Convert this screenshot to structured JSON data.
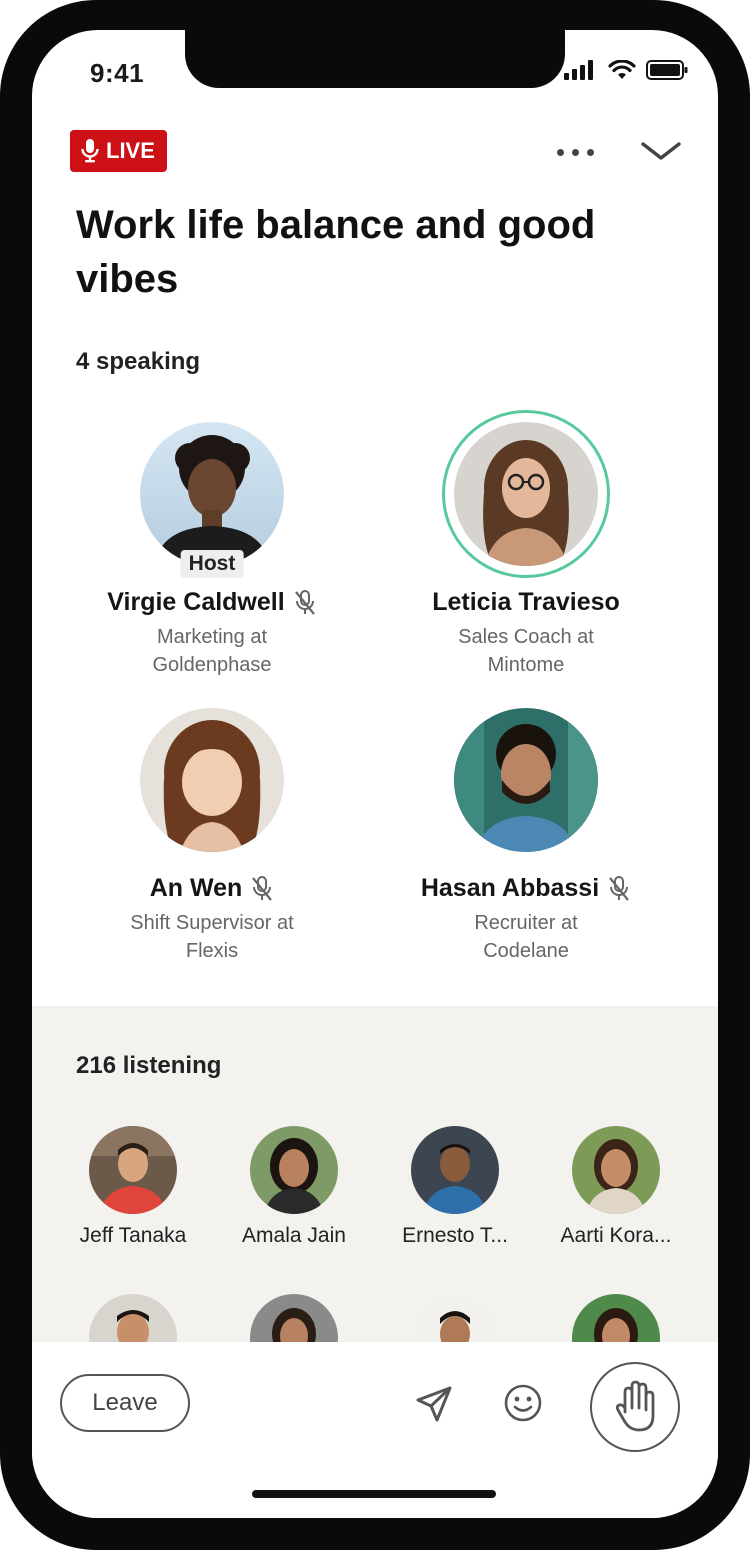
{
  "status_bar": {
    "time": "9:41"
  },
  "header": {
    "live_label": "LIVE",
    "title": "Work life balance and good vibes",
    "colors": {
      "live_badge": "#cc1016",
      "speaking_ring": "#57c99a"
    }
  },
  "speakers_section": {
    "count_label": "4 speaking",
    "speakers": [
      {
        "name": "Virgie Caldwell",
        "subtitle_line1": "Marketing at",
        "subtitle_line2": "Goldenphase",
        "tag": "Host",
        "muted": true
      },
      {
        "name": "Leticia Travieso",
        "subtitle_line1": "Sales Coach at",
        "subtitle_line2": "Mintome",
        "speaking": true,
        "muted": false
      },
      {
        "name": "An Wen",
        "subtitle_line1": "Shift Supervisor at",
        "subtitle_line2": "Flexis",
        "muted": true
      },
      {
        "name": "Hasan Abbassi",
        "subtitle_line1": "Recruiter at",
        "subtitle_line2": "Codelane",
        "muted": true
      }
    ]
  },
  "listeners_section": {
    "count_label": "216 listening",
    "listeners": [
      {
        "name": "Jeff Tanaka"
      },
      {
        "name": "Amala Jain"
      },
      {
        "name": "Ernesto T..."
      },
      {
        "name": "Aarti Kora..."
      }
    ]
  },
  "bottom_bar": {
    "leave_label": "Leave"
  }
}
